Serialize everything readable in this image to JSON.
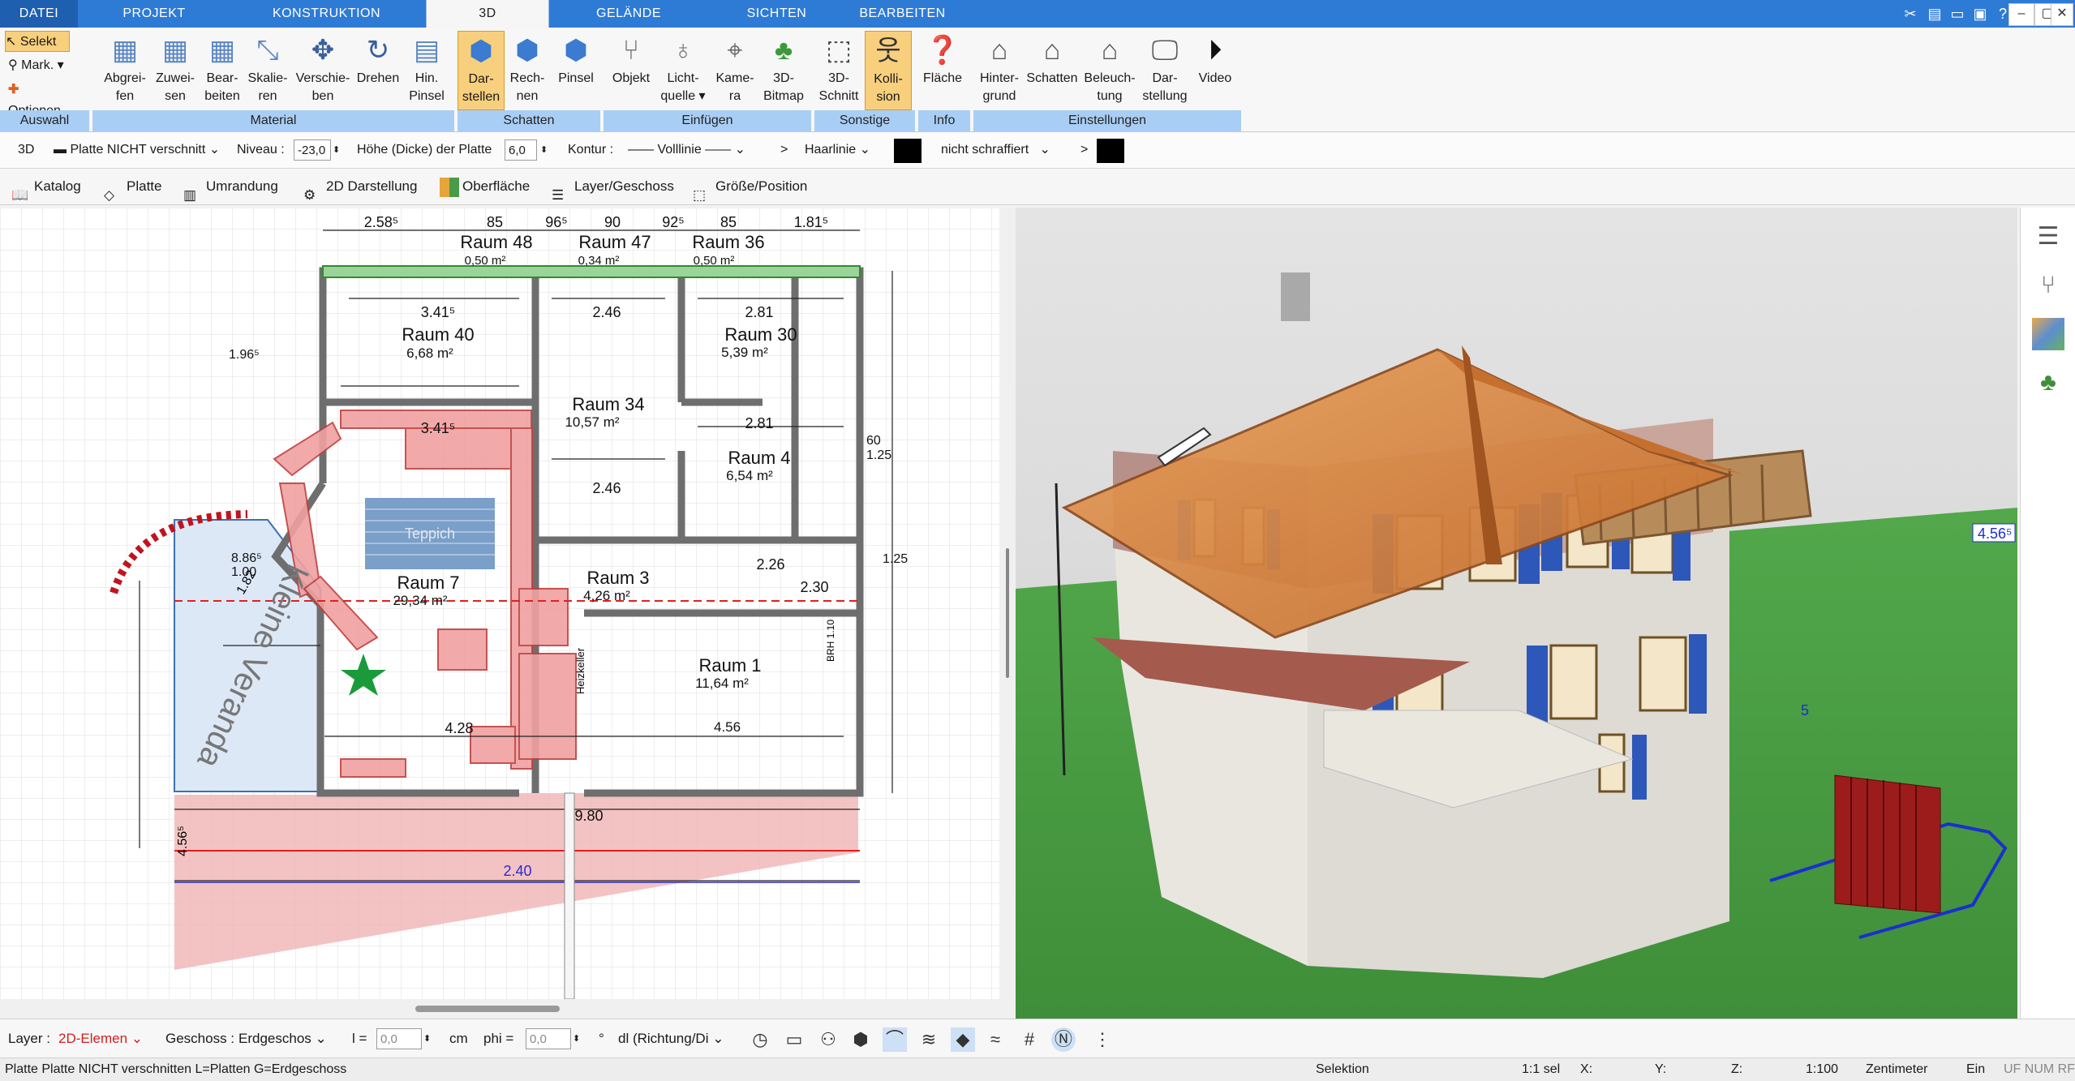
{
  "menu": {
    "tabs": [
      "DATEI",
      "PROJEKT",
      "KONSTRUKTION",
      "3D",
      "GELÄNDE",
      "SICHTEN",
      "BEARBEITEN"
    ],
    "active": "3D"
  },
  "selection": {
    "select_label": "Selekt",
    "mark_label": "Mark.",
    "options_label": "Optionen"
  },
  "ribbon": {
    "groups": [
      "Auswahl",
      "Material",
      "Schatten",
      "Einfügen",
      "Sonstige",
      "Info",
      "Einstellungen"
    ],
    "buttons": {
      "abgreifen": [
        "Abgrei-",
        "fen"
      ],
      "zuweisen": [
        "Zuwei-",
        "sen"
      ],
      "bearbeiten": [
        "Bear-",
        "beiten"
      ],
      "skalieren": [
        "Skalie-",
        "ren"
      ],
      "verschieben": [
        "Verschie-",
        "ben"
      ],
      "drehen": [
        "Drehen",
        ""
      ],
      "hinpinsel": [
        "Hin.",
        "Pinsel"
      ],
      "darstellen": [
        "Dar-",
        "stellen"
      ],
      "rechnen": [
        "Rech-",
        "nen"
      ],
      "pinsel": [
        "Pinsel",
        ""
      ],
      "objekt": [
        "Objekt",
        ""
      ],
      "lichtquelle": [
        "Licht-",
        "quelle ▾"
      ],
      "kamera": [
        "Kame-",
        "ra"
      ],
      "bitmap": [
        "3D-",
        "Bitmap"
      ],
      "schnitt": [
        "3D-",
        "Schnitt"
      ],
      "kollision": [
        "Kolli-",
        "sion"
      ],
      "flaeche": [
        "Fläche",
        ""
      ],
      "hintergrund": [
        "Hinter-",
        "grund"
      ],
      "schatten": [
        "Schatten",
        ""
      ],
      "beleuchtung": [
        "Beleuch-",
        "tung"
      ],
      "darstellung": [
        "Dar-",
        "stellung"
      ],
      "video": [
        "Video",
        ""
      ]
    }
  },
  "options_row": {
    "mode": "3D",
    "plate_select": "Platte NICHT verschnitt",
    "niveau_label": "Niveau :",
    "niveau_value": "-23,0",
    "hoehe_label": "Höhe (Dicke) der Platte",
    "hoehe_value": "6,0",
    "kontur_label": "Kontur :",
    "kontur_value": "Volllinie",
    "haarlinie_label": "Haarlinie",
    "schraffur_value": "nicht schraffiert",
    "arrow": ">",
    "swatch_color": "#000000"
  },
  "tool_row": [
    "Katalog",
    "Platte",
    "Umrandung",
    "2D Darstellung",
    "Oberfläche",
    "Layer/Geschoss",
    "Größe/Position"
  ],
  "plan": {
    "rooms": [
      {
        "name": "Raum 40",
        "area": "6,68 m²"
      },
      {
        "name": "Raum 34",
        "area": "10,57 m²"
      },
      {
        "name": "Raum 30",
        "area": "5,39 m²"
      },
      {
        "name": "Raum 4",
        "area": "6,54 m²"
      },
      {
        "name": "Raum 7",
        "area": "29,34 m²"
      },
      {
        "name": "Raum 3",
        "area": "4,26 m²"
      },
      {
        "name": "Raum 1",
        "area": "11,64 m²"
      },
      {
        "name": "Raum 48",
        "area": "0,50 m²"
      },
      {
        "name": "Raum 47",
        "area": "0,34 m²"
      },
      {
        "name": "Raum 36",
        "area": "0,50 m²"
      }
    ],
    "dims_top": [
      "2.58⁵",
      "85",
      "96⁵",
      "90",
      "92⁵",
      "85",
      "1.81⁵"
    ],
    "dims_misc": [
      "3.41⁵",
      "2.46",
      "2.81",
      "3.41⁵",
      "2.81",
      "2.46",
      "4.28",
      "2.26",
      "9.80",
      "2.40",
      "4.56⁵",
      "2.30",
      "1.82",
      "1.96⁵",
      "8.86⁵",
      "1.00",
      "1.25",
      "60",
      "1.25",
      "4.56"
    ],
    "labels": {
      "teppich": "Teppich",
      "kleine_veranda": "Kleine Veranda",
      "heizkeller": "Heizkeller",
      "brh": "BRH 1.10"
    }
  },
  "view3d": {
    "dimension_label": "4.56⁵",
    "dim_small": "5"
  },
  "bottom": {
    "layer_label": "Layer :",
    "layer_value": "2D-Elemen",
    "geschoss_label": "Geschoss :",
    "geschoss_value": "Erdgeschos",
    "l_label": "l =",
    "l_value": "0,0",
    "cm": "cm",
    "phi_label": "phi =",
    "phi_value": "0,0",
    "deg": "°",
    "dl_value": "dl (Richtung/Di"
  },
  "status": {
    "left": "Platte Platte NICHT verschnitten L=Platten G=Erdgeschoss",
    "selektion": "Selektion",
    "sel": "1:1 sel",
    "x": "X:",
    "y": "Y:",
    "z": "Z:",
    "scale": "1:100",
    "unit": "Zentimeter",
    "ein": "Ein",
    "flags": "UF NUM RF"
  }
}
